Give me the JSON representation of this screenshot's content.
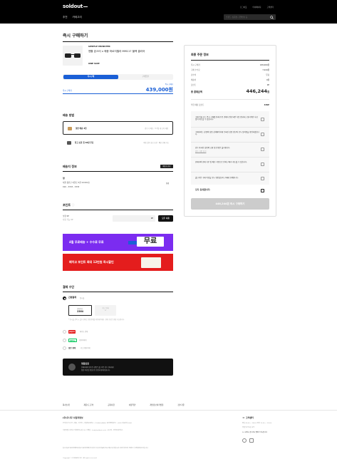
{
  "header": {
    "logo": "soldout",
    "top_links": [
      "로그아웃",
      "마이페이지",
      "고객센터"
    ],
    "nav": [
      "추천",
      "카테고리"
    ],
    "search_placeholder": "브랜드, 상품명, 모델번호 등"
  },
  "page_title": "즉시 구매하기",
  "product": {
    "brand": "GENTLE MONSTER",
    "name": "젠틀 몬스터 x 메종 마르지엘라 MM117 블랙 클리어",
    "size": "ONE SIZE"
  },
  "mode": {
    "active": "즉시구매",
    "inactive": "구매입찰"
  },
  "price": {
    "sub": "즉시 구매가",
    "label": "즉시 구매가",
    "value": "439,000원"
  },
  "shipping": {
    "title": "배송 방법",
    "options": [
      {
        "name": "일반 배송 3천",
        "desc": "검수 후 배송 · 5-7일 내 도착 예정"
      },
      {
        "name": "창고 보관 첫 30일 무료",
        "desc": "배송 없이 창고 보관 · 빠른 판매 가능"
      }
    ]
  },
  "address": {
    "title": "배송지 정보",
    "button": "배송지 추가",
    "name": "정",
    "lines": [
      "서울 용인구 이현로 5길 10 601호",
      "010 - 3333 - 3333"
    ],
    "change": "변경"
  },
  "points": {
    "title": "포인트",
    "labels": [
      "보유 0P",
      "사용 가능 0P"
    ],
    "input_value": "0P",
    "button": "모두 사용"
  },
  "banners": [
    {
      "text": "4월 무료배송 + 수수료 무료",
      "card": "무료"
    },
    {
      "text": "페이코 포인트 최대 12만원 즉시할인"
    }
  ],
  "payment": {
    "title": "결제 수단",
    "method": "간편결제",
    "method_sub": "일시불",
    "card_selected": {
      "line1": "현대카드",
      "line2": "2364"
    },
    "card_other": {
      "line1": "카드 등록",
      "line2": "+"
    },
    "note": "* 일시불 선택 시 할부 결제는 일반결제를 이용해주세요. 결제 수단은 변경 가능합니다.",
    "others": [
      {
        "logo": "payco",
        "text": "페이코 결제"
      },
      {
        "logo": "Pay",
        "text": "네이버페이"
      },
      {
        "logo": "",
        "label": "일반 결제",
        "text": "카드/계좌이체"
      }
    ]
  },
  "notice": {
    "title": "정품인증",
    "lines": [
      "판매자에게 발송된 상품은 솔드아웃 검수 센터에서",
      "정품 여부를 확인한 뒤 안전하게 배송됩니다."
    ]
  },
  "summary": {
    "title": "최종 주문 정보",
    "rows": [
      {
        "label": "즉시 구매가",
        "value": "439,000원"
      },
      {
        "label": "구매 수수료",
        "value": "7,244원"
      },
      {
        "label": "검수비",
        "value": "무료"
      },
      {
        "label": "배송비",
        "value": "0원"
      },
      {
        "label": "포인트",
        "value": "0P"
      }
    ],
    "total_label": "총 결제금액",
    "total_value": "446,244",
    "total_unit": "원",
    "point_label": "적립 예정 포인트",
    "point_value": "439P",
    "checks": [
      {
        "text": "구매 입찰 또는 즉시 구매를 통해 주문 결제가 완료되면 다음 정당하고 합리적인 사유 없이 취소할 수 없습니다."
      },
      {
        "text": "구매하려는 상품의 상품 상세페이지에 등록된 상품 정보와 모두 일치함을 확인하였습니다."
      },
      {
        "text": "검수 통과된 상품의 교환 및 반품은 불가합니다.",
        "sub": "검수 기준 보기"
      },
      {
        "text": "판매자의 판매 거부 및 배송 지연으로 인해 구매가 취소될 수 있습니다."
      },
      {
        "text": "솔드아웃 구매 약관을 모두 확인했으며 구매에 동의합니다."
      }
    ],
    "agree_all": "모두 동의합니다.",
    "buy_button": "446,244원 즉시 구매하기"
  },
  "footer": {
    "nav": [
      "회사소개",
      "제휴/도 문의",
      "공지사항",
      "이용약관",
      "개인정보처리방침",
      "검수기준"
    ],
    "company_title": "(주)두나무 사업자정보",
    "company_lines": [
      "주식회사 두나무 | 대표 : 이석우 | 사업자등록번호 : 119-86-54968 | 통신판매업신고 : 2022-서울강남-0000",
      "서울특별시 강남구 테헤란로 4길 14 | 이메일 : help@soldout.co.kr | 호스팅 : 아마존웹서비스",
      "솔드아웃은 통신판매중개자로서 통신판매의 당사자가 아니며 상품의 주문·배송 및 환불 등과 관련한 의무와 책임은 각 판매자에게 있습니다.",
      "Copyright © DUNAMU INC. All rights reserved."
    ],
    "cs_title": "고객센터",
    "cs_lines": [
      "평일 09:00 ~ 18:00 (점심 12:00 ~ 13:00)",
      "주말 및 공휴일 휴무",
      "1:1 문의는 솔드아웃 앱에서 가능합니다."
    ]
  },
  "colors": {
    "accent": "#1a5fd6",
    "purple": "#7b2cf0",
    "red": "#e41d1d"
  }
}
